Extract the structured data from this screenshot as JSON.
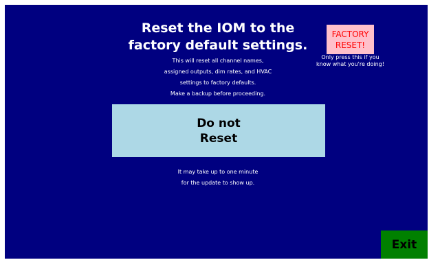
{
  "colors": {
    "background": "#000080",
    "factory_button_bg": "#ffc0cb",
    "factory_button_text": "#ff0000",
    "no_reset_button_bg": "#add8e6",
    "exit_button_bg": "#008000"
  },
  "title": {
    "line1": "Reset the IOM to the",
    "line2": "factory default settings."
  },
  "description": {
    "line1": "This will reset all channel names,",
    "line2": "assigned outputs, dim rates, and HVAC",
    "line3": "settings to factory defaults.",
    "line4": "Make a backup before proceeding."
  },
  "factory_reset": {
    "label_line1": "FACTORY",
    "label_line2": "RESET!",
    "warning_line1": "Only press this if you",
    "warning_line2": "know what you're doing!"
  },
  "no_reset": {
    "label_line1": "Do not",
    "label_line2": "Reset"
  },
  "note": {
    "line1": "It may take up to one minute",
    "line2": "for the update to show up."
  },
  "exit": {
    "label": "Exit"
  }
}
